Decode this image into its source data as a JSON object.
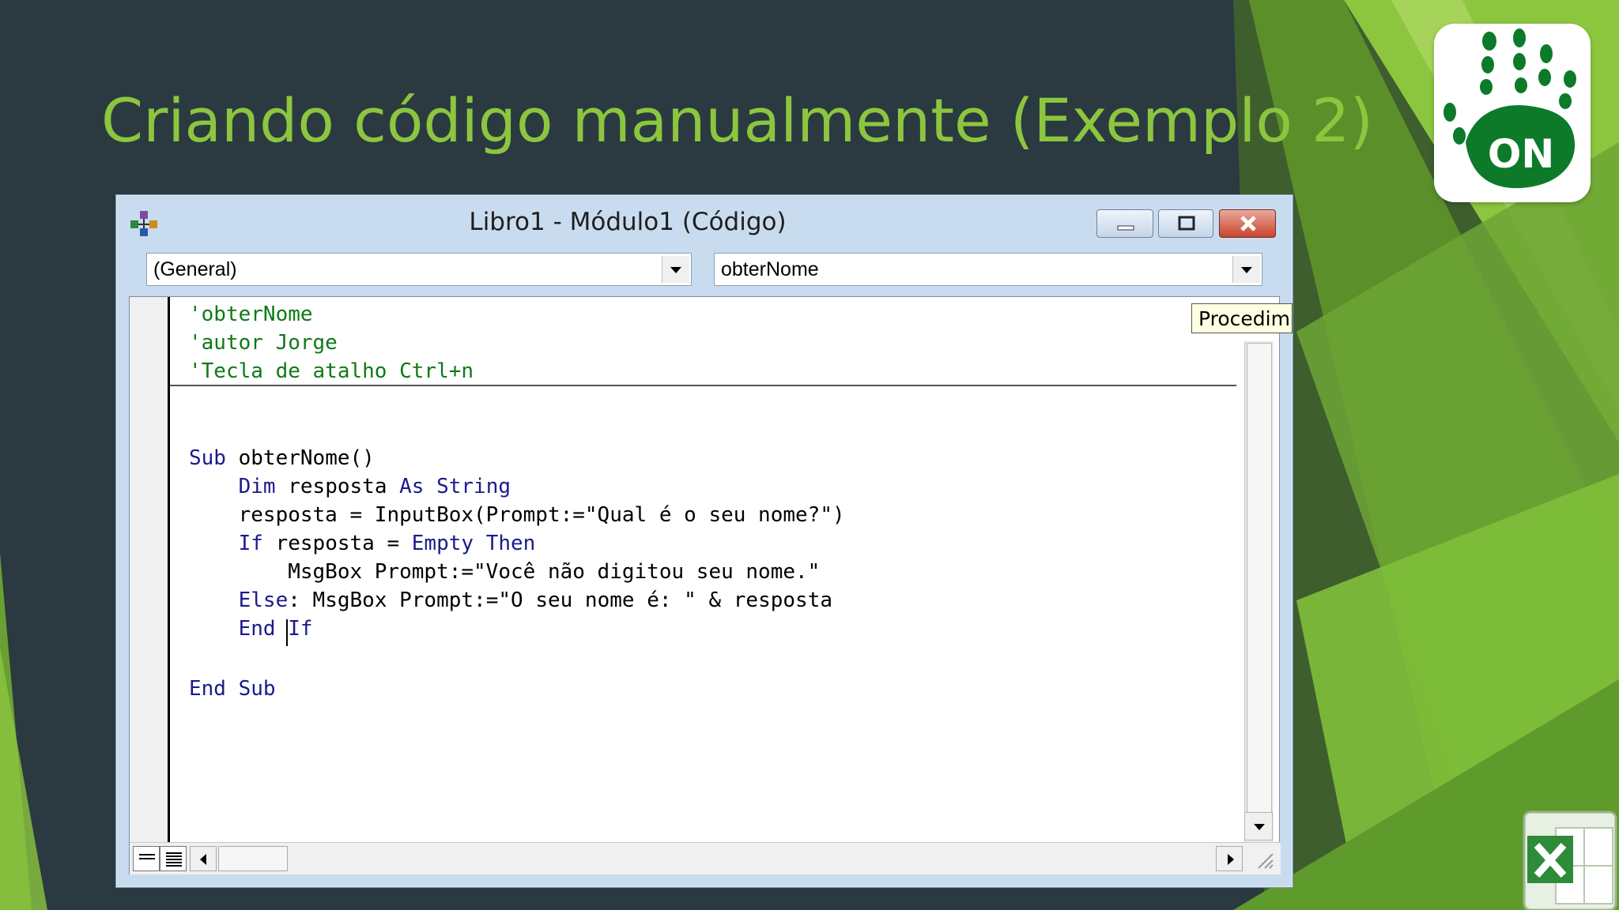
{
  "slide": {
    "title": "Criando código manualmente (Exemplo 2)",
    "logo_on_text": "ON",
    "logo_excel_icon": "excel-logo-icon"
  },
  "window": {
    "title": "Libro1 - Módulo1 (Código)",
    "object_combo": "(General)",
    "procedure_combo": "obterNome",
    "tooltip": "Procedimie"
  },
  "code": {
    "lines": [
      [
        {
          "t": "'obterNome",
          "c": "cm"
        }
      ],
      [
        {
          "t": "'autor Jorge",
          "c": "cm"
        }
      ],
      [
        {
          "t": "'Tecla de atalho Ctrl+n",
          "c": "cm"
        }
      ],
      [],
      [
        {
          "t": "Sub",
          "c": "kw"
        },
        {
          "t": " obterNome()",
          "c": ""
        }
      ],
      [
        {
          "t": "    ",
          "c": ""
        },
        {
          "t": "Dim",
          "c": "kw"
        },
        {
          "t": " resposta ",
          "c": ""
        },
        {
          "t": "As String",
          "c": "kw"
        }
      ],
      [
        {
          "t": "    resposta = InputBox(Prompt:=\"Qual é o seu nome?\")",
          "c": ""
        }
      ],
      [
        {
          "t": "    ",
          "c": ""
        },
        {
          "t": "If",
          "c": "kw"
        },
        {
          "t": " resposta = ",
          "c": ""
        },
        {
          "t": "Empty Then",
          "c": "kw"
        }
      ],
      [
        {
          "t": "        MsgBox Prompt:=\"Você não digitou seu nome.\"",
          "c": ""
        }
      ],
      [
        {
          "t": "    ",
          "c": ""
        },
        {
          "t": "Else",
          "c": "kw"
        },
        {
          "t": ": MsgBox Prompt:=\"O seu nome é: \" & resposta",
          "c": ""
        }
      ],
      [
        {
          "t": "    ",
          "c": ""
        },
        {
          "t": "End If",
          "c": "kw"
        }
      ],
      [],
      [
        {
          "t": "End Sub",
          "c": "kw"
        }
      ]
    ]
  },
  "colors": {
    "title_green": "#8cc63f",
    "comment_green": "#0f7a16",
    "keyword_blue": "#1a1a8c",
    "background_dark": "#2b3a40"
  }
}
